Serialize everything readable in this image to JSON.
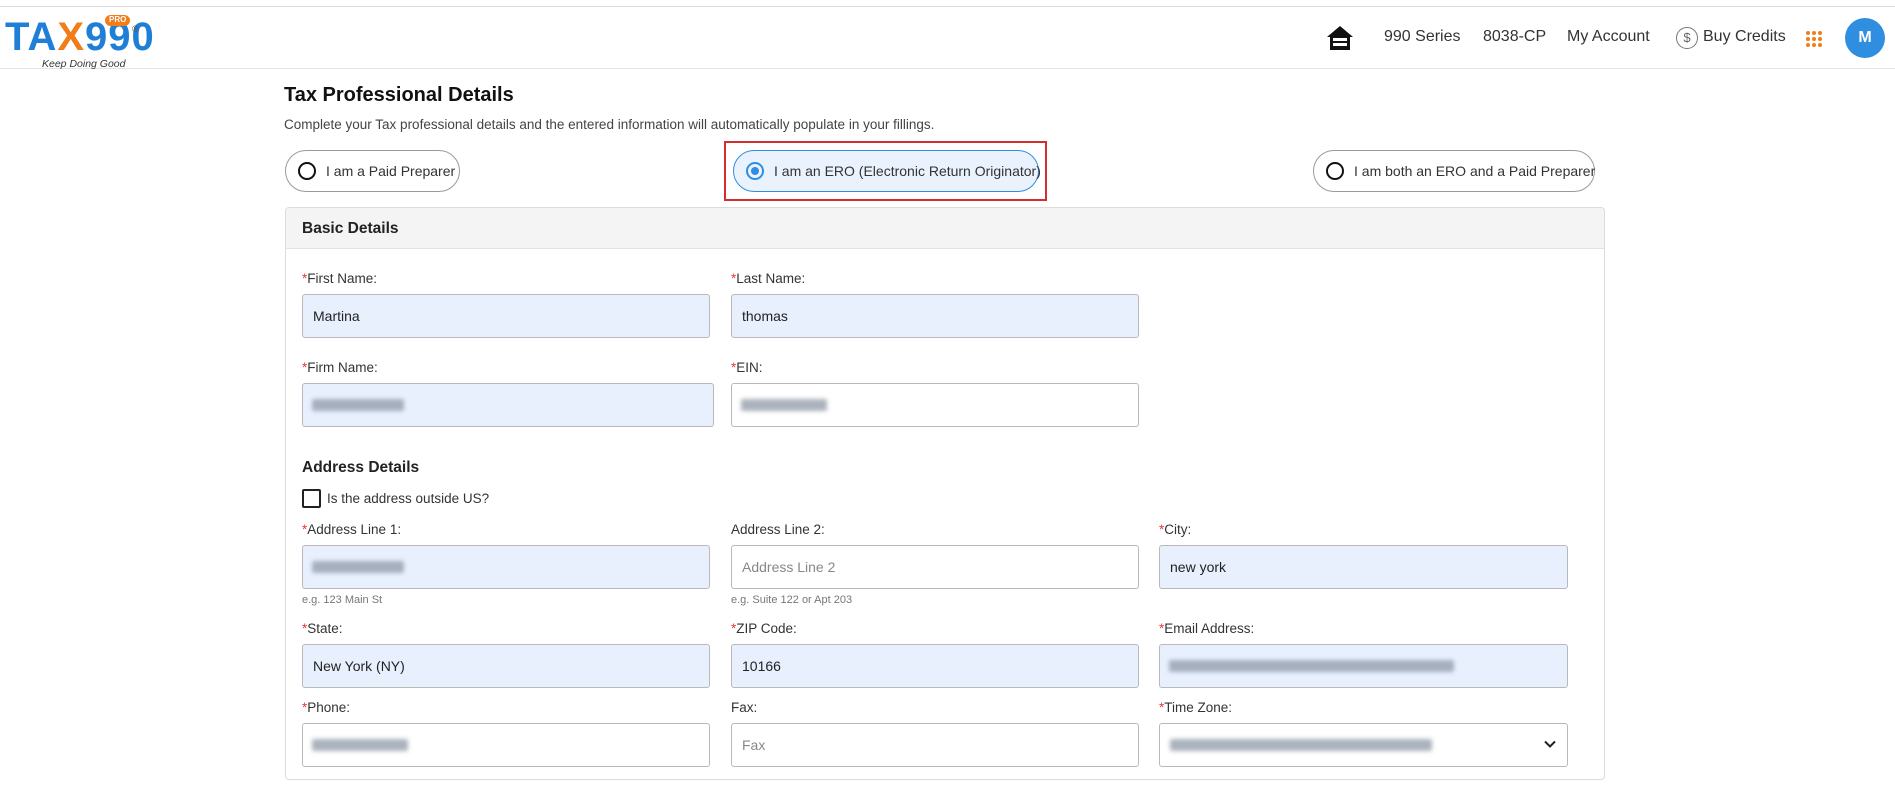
{
  "header": {
    "logo": {
      "text": "TAX990",
      "badge": "PRO",
      "reg": "®",
      "tagline": "Keep Doing Good"
    },
    "nav": {
      "home_icon": "home-icon",
      "series": "990 Series",
      "form": "8038-CP",
      "account": "My Account",
      "credits_symbol": "$",
      "credits": "Buy Credits",
      "apps_icon": "apps-grid-icon",
      "avatar_initial": "M"
    }
  },
  "page": {
    "title": "Tax Professional Details",
    "subtitle": "Complete your Tax professional details and the entered information will automatically populate in your fillings."
  },
  "role_options": [
    {
      "label": "I am a Paid Preparer",
      "selected": false
    },
    {
      "label": "I am an ERO (Electronic Return Originator)",
      "selected": true
    },
    {
      "label": "I am both an ERO and a Paid Preparer",
      "selected": false
    }
  ],
  "basic": {
    "heading": "Basic Details",
    "first_name": {
      "label": "First Name:",
      "value": "Martina"
    },
    "last_name": {
      "label": "Last Name:",
      "value": "thomas"
    },
    "firm_name": {
      "label": "Firm Name:"
    },
    "ein": {
      "label": "EIN:"
    }
  },
  "address": {
    "heading": "Address Details",
    "outside_us": "Is the address outside US?",
    "line1": {
      "label": "Address Line 1:",
      "hint": "e.g. 123 Main St"
    },
    "line2": {
      "label": "Address Line 2:",
      "placeholder": "Address Line 2",
      "hint": "e.g. Suite 122 or Apt 203"
    },
    "city": {
      "label": "City:",
      "value": "new york"
    },
    "state": {
      "label": "State:",
      "value": "New York (NY)"
    },
    "zip": {
      "label": "ZIP Code:",
      "value": "10166"
    },
    "email": {
      "label": "Email Address:"
    },
    "phone": {
      "label": "Phone:"
    },
    "fax": {
      "label": "Fax:",
      "placeholder": "Fax"
    },
    "timezone": {
      "label": "Time Zone:"
    }
  },
  "required_marker": "*",
  "colors": {
    "brand_blue": "#1f7fd6",
    "brand_orange": "#f07d1a",
    "required": "#e53935",
    "highlight": "#d32f2f"
  }
}
